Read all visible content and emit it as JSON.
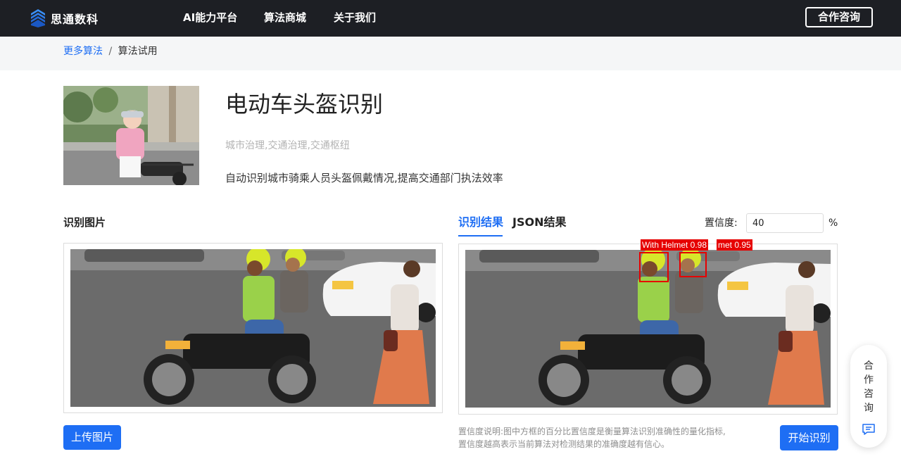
{
  "brand": {
    "name": "思通数科"
  },
  "nav": {
    "items": [
      "AI能力平台",
      "算法商城",
      "关于我们"
    ],
    "contact_label": "合作咨询"
  },
  "breadcrumb": {
    "link": "更多算法",
    "separator": "/",
    "current": "算法试用"
  },
  "algorithm": {
    "title": "电动车头盔识别",
    "tags": "城市治理,交通治理,交通枢纽",
    "description": "自动识别城市骑乘人员头盔佩戴情况,提高交通部门执法效率"
  },
  "left": {
    "label": "识别图片",
    "upload_label": "上传图片"
  },
  "right": {
    "tabs": [
      "识别结果",
      "JSON结果"
    ],
    "confidence_label": "置信度:",
    "confidence_value": "40",
    "confidence_unit": "%",
    "note_line1": "置信度说明:图中方框的百分比置信度是衡量算法识别准确性的量化指标,",
    "note_line2": "置信度越高表示当前算法对检测结果的准确度越有信心。",
    "start_label": "开始识别",
    "detections": [
      {
        "label": "With Helmet 0.98"
      },
      {
        "label": "met 0.95"
      }
    ]
  },
  "float_widget": {
    "chars": [
      "合",
      "作",
      "咨",
      "询"
    ],
    "icon": "chat-icon"
  },
  "colors": {
    "accent": "#1e6ef4",
    "nav_bg": "#1d1f24",
    "detection": "#e60000"
  }
}
